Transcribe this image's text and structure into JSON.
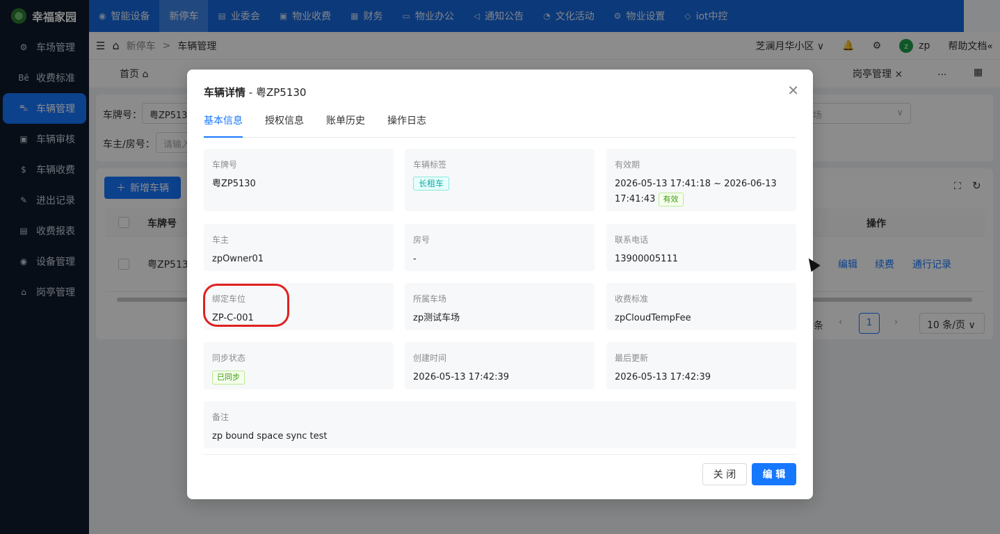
{
  "app": {
    "title": "幸福家园"
  },
  "sidebar": {
    "items": [
      {
        "label": "车场管理",
        "icon": "gear-icon",
        "active": false
      },
      {
        "label": "收费标准",
        "icon": "behance-icon",
        "active": false
      },
      {
        "label": "车辆管理",
        "icon": "car-icon",
        "active": true
      },
      {
        "label": "车辆审核",
        "icon": "audit-icon",
        "active": false
      },
      {
        "label": "车辆收费",
        "icon": "dollar-icon",
        "active": false
      },
      {
        "label": "进出记录",
        "icon": "record-icon",
        "active": false
      },
      {
        "label": "收费报表",
        "icon": "report-icon",
        "active": false
      },
      {
        "label": "设备管理",
        "icon": "device-icon",
        "active": false
      },
      {
        "label": "岗亭管理",
        "icon": "bank-icon",
        "active": false
      }
    ]
  },
  "topnav": {
    "items": [
      {
        "label": "智能设备",
        "icon": "device-icon",
        "active": false
      },
      {
        "label": "新停车",
        "icon": "",
        "active": true
      },
      {
        "label": "业委会",
        "icon": "doc-icon",
        "active": false
      },
      {
        "label": "物业收费",
        "icon": "fee-icon",
        "active": false
      },
      {
        "label": "财务",
        "icon": "calendar-icon",
        "active": false
      },
      {
        "label": "物业办公",
        "icon": "monitor-icon",
        "active": false
      },
      {
        "label": "通知公告",
        "icon": "megaphone-icon",
        "active": false
      },
      {
        "label": "文化活动",
        "icon": "tag-icon",
        "active": false
      },
      {
        "label": "物业设置",
        "icon": "gear-icon",
        "active": false
      },
      {
        "label": "iot中控",
        "icon": "cube-icon",
        "active": false
      }
    ]
  },
  "header": {
    "breadcrumb": [
      "新停车",
      ">",
      "车辆管理"
    ],
    "community": "芝澜月华小区",
    "user": "zp",
    "avatar_letter": "z",
    "help": "帮助文档"
  },
  "tabs": {
    "home": "首页",
    "right_tab": "岗亭管理",
    "more": "..."
  },
  "filters": {
    "plate_label": "车牌号：",
    "plate_value": "粤ZP513",
    "owner_label": "车主/房号：",
    "owner_placeholder": "请输入",
    "lot_placeholder": "场"
  },
  "table": {
    "add_button": "新增车辆",
    "col_plate": "车牌号",
    "col_ops": "操作",
    "row_plate": "粤ZP513",
    "ops": [
      "编辑",
      "续费",
      "通行记录"
    ],
    "pager_suffix": "条",
    "page": "1",
    "page_size": "10 条/页"
  },
  "modal": {
    "title": "车辆详情",
    "title_sub": " - 粤ZP5130",
    "tabs": [
      "基本信息",
      "授权信息",
      "账单历史",
      "操作日志"
    ],
    "active_tab": 0,
    "fields": {
      "plate": {
        "label": "车牌号",
        "value": "粤ZP5130"
      },
      "tag": {
        "label": "车辆标签",
        "value": "长租车"
      },
      "validity": {
        "label": "有效期",
        "value": "2026-05-13 17:41:18 ~ 2026-06-13 17:41:43",
        "badge": "有效"
      },
      "owner": {
        "label": "车主",
        "value": "zpOwner01"
      },
      "room": {
        "label": "房号",
        "value": "-"
      },
      "phone": {
        "label": "联系电话",
        "value": "13900005111"
      },
      "space": {
        "label": "绑定车位",
        "value": "ZP-C-001"
      },
      "lot": {
        "label": "所属车场",
        "value": "zp测试车场"
      },
      "fee": {
        "label": "收费标准",
        "value": "zpCloudTempFee"
      },
      "sync": {
        "label": "同步状态",
        "value": "已同步"
      },
      "created": {
        "label": "创建时间",
        "value": "2026-05-13 17:42:39"
      },
      "updated": {
        "label": "最后更新",
        "value": "2026-05-13 17:42:39"
      },
      "remark": {
        "label": "备注",
        "value": "zp bound space sync test"
      }
    },
    "close_button": "关 闭",
    "edit_button": "编 辑"
  },
  "colors": {
    "primary": "#1677ff",
    "sidebar_bg": "#0f1b2d",
    "topnav_bg": "#1668dc",
    "highlight": "#e02020"
  }
}
